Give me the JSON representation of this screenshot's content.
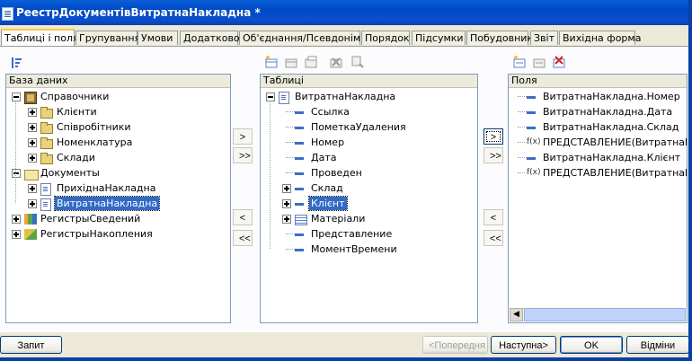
{
  "window": {
    "title": "РеестрДокументівВитратнаНакладна *"
  },
  "tabs": [
    {
      "label": "Таблиці і поля",
      "active": true
    },
    {
      "label": "Групування"
    },
    {
      "label": "Умови"
    },
    {
      "label": "Додатково"
    },
    {
      "label": "Об'єднання/Псевдоніми"
    },
    {
      "label": "Порядок"
    },
    {
      "label": "Підсумки"
    },
    {
      "label": "Побудовник"
    },
    {
      "label": "Звіт"
    },
    {
      "label": "Вихідна форма"
    }
  ],
  "database": {
    "header": "База даних",
    "items": [
      {
        "label": "Справочники",
        "icon": "book-icon"
      },
      {
        "label": "Клієнти",
        "icon": "folder-icon"
      },
      {
        "label": "Співробітники",
        "icon": "folder-icon"
      },
      {
        "label": "Номенклатура",
        "icon": "folder-icon"
      },
      {
        "label": "Склади",
        "icon": "folder-icon"
      },
      {
        "label": "Документы",
        "icon": "documents-icon"
      },
      {
        "label": "ПрихіднаНакладна",
        "icon": "document-icon"
      },
      {
        "label": "ВитратнаНакладна",
        "icon": "document-icon",
        "selected": true
      },
      {
        "label": "РегистрыСведений",
        "icon": "register-icon"
      },
      {
        "label": "РегистрыНакопления",
        "icon": "accumulation-icon"
      }
    ]
  },
  "tables": {
    "header": "Таблиці",
    "items": [
      {
        "label": "ВитратнаНакладна",
        "icon": "document-icon"
      },
      {
        "label": "Ссылка",
        "icon": "field-icon"
      },
      {
        "label": "ПометкаУдаления",
        "icon": "field-icon"
      },
      {
        "label": "Номер",
        "icon": "field-icon"
      },
      {
        "label": "Дата",
        "icon": "field-icon"
      },
      {
        "label": "Проведен",
        "icon": "field-icon"
      },
      {
        "label": "Склад",
        "icon": "field-icon"
      },
      {
        "label": "Клієнт",
        "icon": "field-icon",
        "selected": true
      },
      {
        "label": "Матеріали",
        "icon": "table-icon"
      },
      {
        "label": "Представление",
        "icon": "field-icon"
      },
      {
        "label": "МоментВремени",
        "icon": "field-icon"
      }
    ]
  },
  "fields": {
    "header": "Поля",
    "items": [
      {
        "label": "ВитратнаНакладна.Номер",
        "icon": "field-icon"
      },
      {
        "label": "ВитратнаНакладна.Дата",
        "icon": "field-icon"
      },
      {
        "label": "ВитратнаНакладна.Склад",
        "icon": "field-icon"
      },
      {
        "label": "ПРЕДСТАВЛЕНИЕ(ВитратнаНакладна.Склад)",
        "icon": "function-icon",
        "fx": "f(x)"
      },
      {
        "label": "ВитратнаНакладна.Клієнт",
        "icon": "field-icon"
      },
      {
        "label": "ПРЕДСТАВЛЕНИЕ(ВитратнаНакладна.Клієнт)",
        "icon": "function-icon",
        "fx": "f(x)"
      }
    ]
  },
  "transfer": {
    "add_one": ">",
    "add_all": ">>",
    "remove_one": "<",
    "remove_all": "<<"
  },
  "buttons": {
    "query": "Запит",
    "back": "<Попередня",
    "next": "Наступна>",
    "ok": "OK",
    "cancel": "Відміни"
  },
  "colors": {
    "title_bar": "#0a4fcf",
    "selection": "#316ac5",
    "tab_highlight": "#ffc83c"
  }
}
